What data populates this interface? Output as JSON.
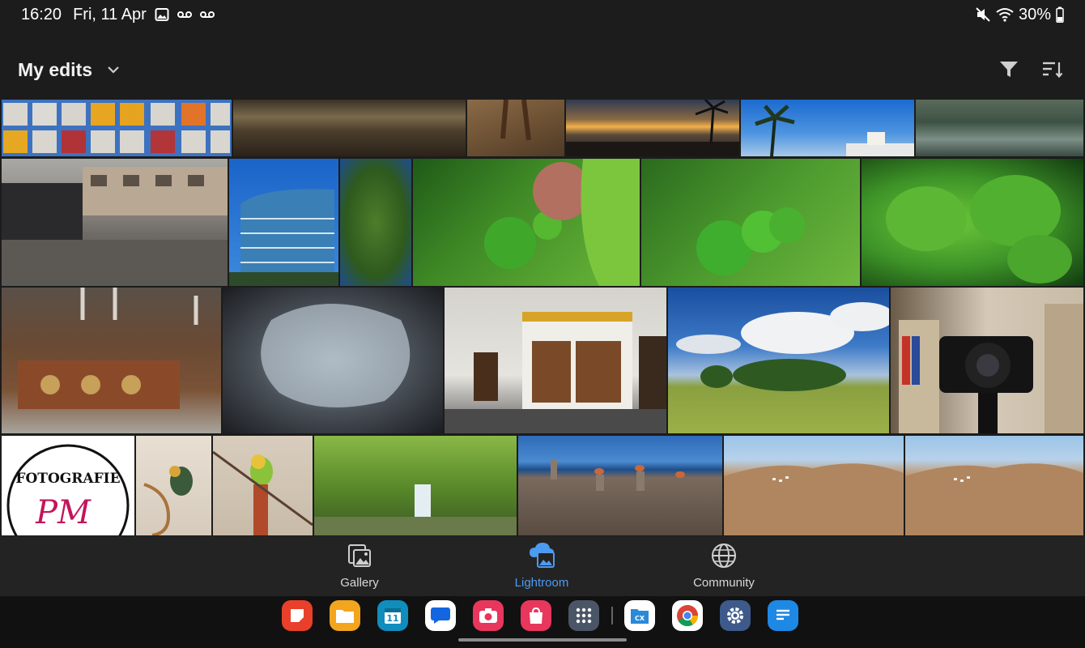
{
  "status_bar": {
    "time": "16:20",
    "date": "Fri, 11 Apr",
    "battery": "30%",
    "icons": [
      "gallery-notification-icon",
      "voicemail-icon",
      "voicemail-icon",
      "mute-icon",
      "wifi-icon",
      "battery-icon"
    ]
  },
  "header": {
    "title": "My edits",
    "chevron_icon": "chevron-down-icon",
    "filter_icon": "filter-icon",
    "sort_icon": "sort-icon"
  },
  "photos": [
    {
      "name": "photo-colored-squares"
    },
    {
      "name": "photo-beach-sunset"
    },
    {
      "name": "photo-sand-legs"
    },
    {
      "name": "photo-palm-sunset"
    },
    {
      "name": "photo-palm-blue-sky"
    },
    {
      "name": "photo-resort-garden"
    },
    {
      "name": "photo-town-square-concert"
    },
    {
      "name": "photo-blue-office-building"
    },
    {
      "name": "photo-green-tree"
    },
    {
      "name": "photo-green-tomatoes-1"
    },
    {
      "name": "photo-green-tomatoes-2"
    },
    {
      "name": "photo-wet-leaves"
    },
    {
      "name": "photo-rusty-machine"
    },
    {
      "name": "photo-ice-texture"
    },
    {
      "name": "photo-bakery-storefront"
    },
    {
      "name": "photo-meadow-clouds"
    },
    {
      "name": "photo-camera-on-tripod"
    },
    {
      "name": "photo-fotografie-pm-logo"
    },
    {
      "name": "photo-parrot-1"
    },
    {
      "name": "photo-parrot-2"
    },
    {
      "name": "photo-forest-waterfall"
    },
    {
      "name": "photo-stone-cairns"
    },
    {
      "name": "photo-mountain-village-1"
    },
    {
      "name": "photo-mountain-village-2"
    }
  ],
  "logo_text": {
    "line1": "FOTOGRAFIE",
    "line2": "PM"
  },
  "bottom_nav": {
    "items": [
      {
        "label": "Gallery",
        "icon": "gallery-icon",
        "active": false
      },
      {
        "label": "Lightroom",
        "icon": "lightroom-cloud-icon",
        "active": true
      },
      {
        "label": "Community",
        "icon": "globe-icon",
        "active": false
      }
    ]
  },
  "dock": {
    "apps": [
      {
        "name": "notes-app-icon",
        "color": "#e8402a"
      },
      {
        "name": "files-app-icon",
        "color": "#f3a51e"
      },
      {
        "name": "calendar-app-icon",
        "color": "#0f8dbd",
        "text": "11"
      },
      {
        "name": "messages-app-icon",
        "color": "#ffffff"
      },
      {
        "name": "camera-app-icon",
        "color": "#e8365c"
      },
      {
        "name": "store-app-icon",
        "color": "#e8365c"
      },
      {
        "name": "app-drawer-icon",
        "color": "#4a5566"
      },
      {
        "name": "cx-file-explorer-icon",
        "color": "#ffffff",
        "text": "CX"
      },
      {
        "name": "chrome-app-icon",
        "color": "#ffffff"
      },
      {
        "name": "settings-app-icon",
        "color": "#3d5a8a"
      },
      {
        "name": "docs-app-icon",
        "color": "#1e88e5"
      }
    ]
  },
  "colors": {
    "accent": "#4d9bf0",
    "background": "#1c1c1c",
    "nav_bg": "#232323",
    "dock_bg": "#111111"
  }
}
